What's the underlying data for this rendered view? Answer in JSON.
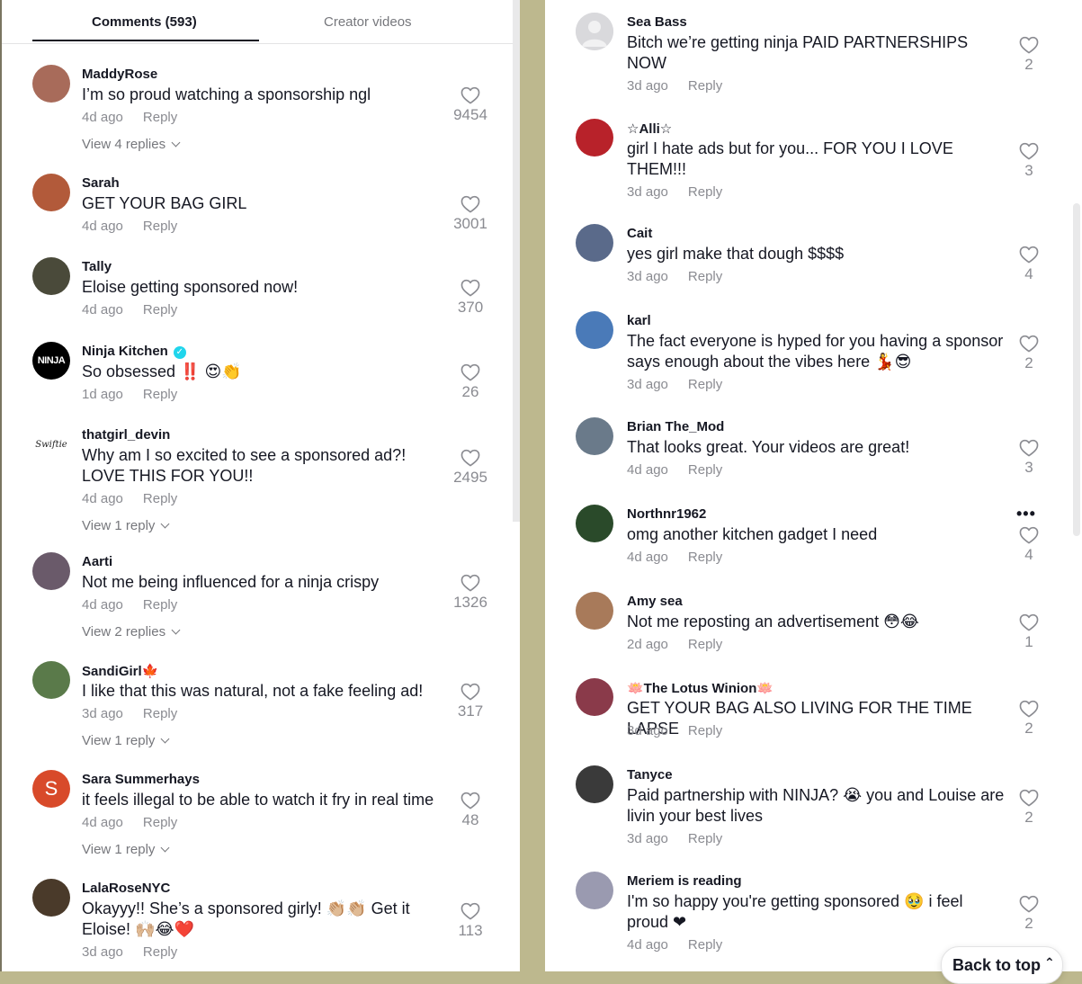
{
  "tabs": {
    "comments_label": "Comments (593)",
    "creator_label": "Creator videos"
  },
  "left_comments": [
    {
      "user": "MaddyRose",
      "text": "I’m so proud watching a sponsorship ngl",
      "time": "4d ago",
      "reply": "Reply",
      "likes": "9454",
      "replies": "View 4 replies",
      "avatar_color": "#a86b5a"
    },
    {
      "user": "Sarah",
      "text": "GET YOUR BAG GIRL",
      "time": "4d ago",
      "reply": "Reply",
      "likes": "3001",
      "replies": "",
      "avatar_color": "#b25a3a"
    },
    {
      "user": "Tally",
      "text": "Eloise getting sponsored now!",
      "time": "4d ago",
      "reply": "Reply",
      "likes": "370",
      "replies": "",
      "avatar_color": "#4a4a3a"
    },
    {
      "user": "Ninja Kitchen",
      "text": "So obsessed ‼️ 😍👏",
      "time": "1d ago",
      "reply": "Reply",
      "likes": "26",
      "replies": "",
      "avatar_color": "#000000",
      "verified": true,
      "avatar_text": "NINJA"
    },
    {
      "user": "thatgirl_devin",
      "text": "Why am I so excited to see a sponsored ad?! LOVE THIS FOR YOU!!",
      "time": "4d ago",
      "reply": "Reply",
      "likes": "2495",
      "replies": "View 1 reply",
      "avatar_color": "#ffffff",
      "avatar_text": "Swiftie"
    },
    {
      "user": "Aarti",
      "text": "Not me being influenced for a ninja crispy",
      "time": "4d ago",
      "reply": "Reply",
      "likes": "1326",
      "replies": "View 2 replies",
      "avatar_color": "#6a5a6a"
    },
    {
      "user": "SandiGirl🍁",
      "text": "I like that this was natural, not a fake feeling ad!",
      "time": "3d ago",
      "reply": "Reply",
      "likes": "317",
      "replies": "View 1 reply",
      "avatar_color": "#5a7a4a"
    },
    {
      "user": "Sara Summerhays",
      "text": "it feels illegal to be able to watch it fry in real time",
      "time": "4d ago",
      "reply": "Reply",
      "likes": "48",
      "replies": "View 1 reply",
      "avatar_color": "#d84a2a",
      "avatar_text": "S"
    },
    {
      "user": "LalaRoseNYC",
      "text": "Okayyy!! She’s a sponsored girly! 👏🏼👏🏼 Get it Eloise! 🙌🏼😂❤️",
      "time": "3d ago",
      "reply": "Reply",
      "likes": "113",
      "replies": "",
      "avatar_color": "#4a3a2a"
    }
  ],
  "right_comments": [
    {
      "user": "Sea Bass",
      "text": "Bitch we’re getting ninja PAID PARTNERSHIPS NOW",
      "time": "3d ago",
      "reply": "Reply",
      "likes": "2",
      "avatar_color": "#d5d5d8",
      "default_avatar": true
    },
    {
      "user": "☆Alli☆",
      "text": "girl I hate ads but for you... FOR YOU I LOVE THEM!!!",
      "time": "3d ago",
      "reply": "Reply",
      "likes": "3",
      "avatar_color": "#b8222a"
    },
    {
      "user": "Cait",
      "text": "yes girl make that dough $$$$",
      "time": "3d ago",
      "reply": "Reply",
      "likes": "4",
      "avatar_color": "#5a6a8a"
    },
    {
      "user": "karl",
      "text": "The fact everyone is hyped for you having a sponsor says enough about the vibes here 💃😎",
      "time": "3d ago",
      "reply": "Reply",
      "likes": "2",
      "avatar_color": "#4a7ab8"
    },
    {
      "user": "Brian The_Mod",
      "text": "That looks great. Your videos are great!",
      "time": "4d ago",
      "reply": "Reply",
      "likes": "3",
      "avatar_color": "#6a7a8a"
    },
    {
      "user": "Northnr1962",
      "text": "omg another kitchen gadget I need",
      "time": "4d ago",
      "reply": "Reply",
      "likes": "4",
      "avatar_color": "#2a4a2a",
      "more": "•••"
    },
    {
      "user": "Amy sea",
      "text": "Not me reposting an advertisement 😳😂",
      "time": "2d ago",
      "reply": "Reply",
      "likes": "1",
      "avatar_color": "#a87a5a"
    },
    {
      "user": "🪷The Lotus Winion🪷",
      "text": "GET YOUR BAG ALSO LIVING FOR THE TIME LAPSE",
      "time": "3d ago",
      "reply": "Reply",
      "likes": "2",
      "avatar_color": "#8a3a4a"
    },
    {
      "user": "Tanyce",
      "text": "Paid partnership with NINJA? 😭 you and Louise are livin your best lives",
      "time": "3d ago",
      "reply": "Reply",
      "likes": "2",
      "avatar_color": "#3a3a3a"
    },
    {
      "user": "Meriem is reading",
      "text": "I'm so happy you're getting sponsored 🥹 i feel proud ❤",
      "time": "4d ago",
      "reply": "Reply",
      "likes": "2",
      "avatar_color": "#9a9ab0"
    }
  ],
  "back_to_top": "Back to top",
  "back_to_top_icon": "double-chevron-up-icon",
  "colors": {
    "text": "#161823",
    "muted": "#8a8b91",
    "verified": "#20d5ec",
    "backdrop": "#bdb88e"
  }
}
